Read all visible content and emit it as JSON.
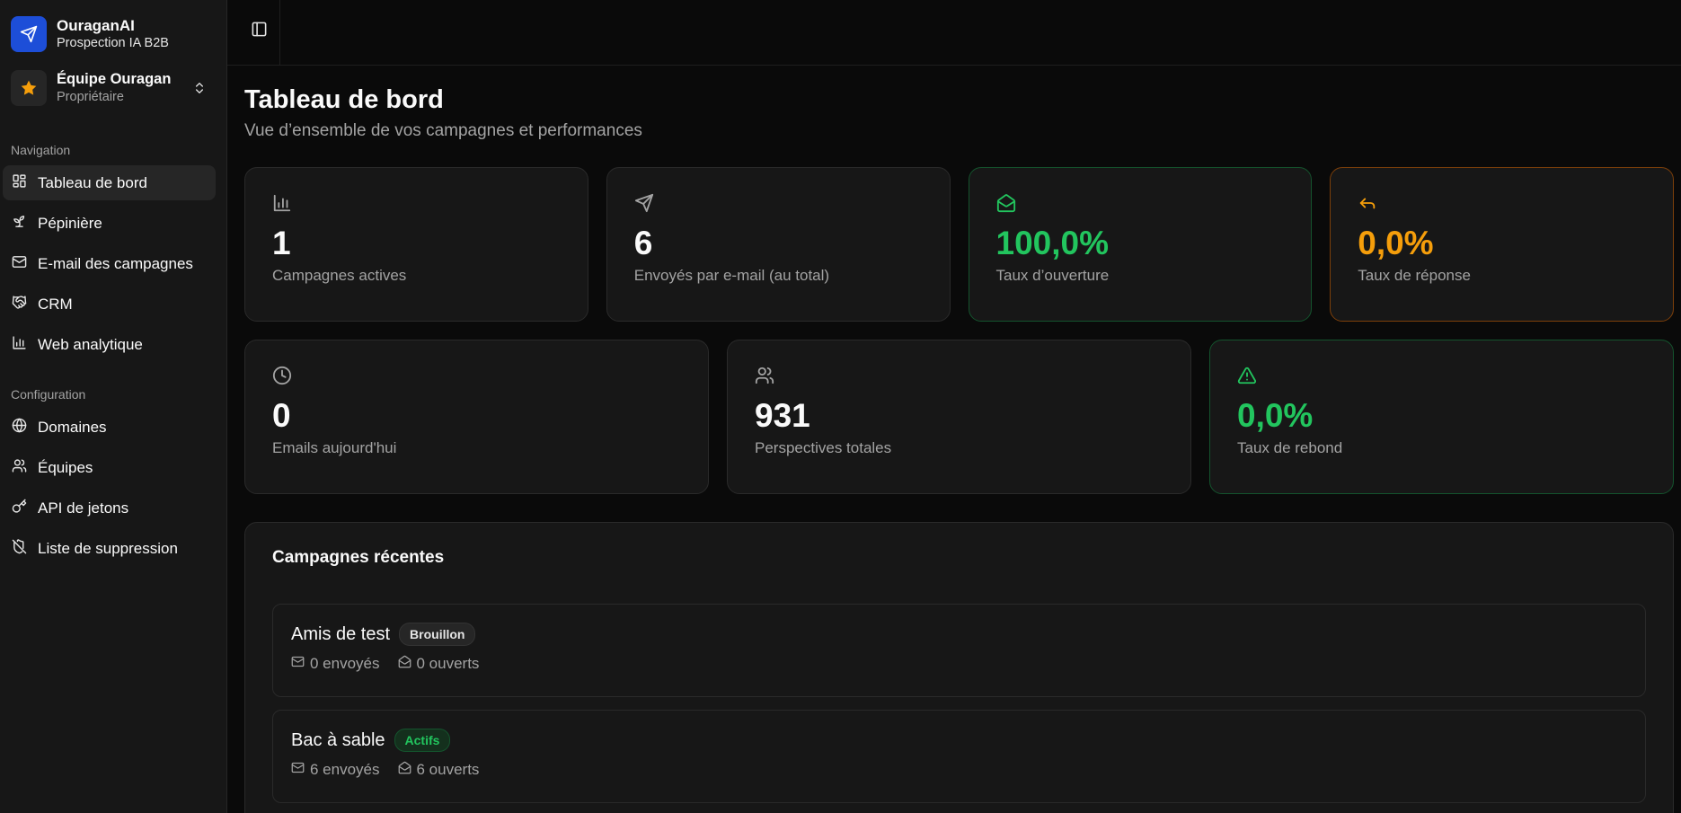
{
  "brand": {
    "name": "OuraganAI",
    "tagline": "Prospection IA B2B",
    "logo_icon": "send-icon"
  },
  "team": {
    "name": "Équipe Ouragan",
    "role": "Propriétaire",
    "icon": "star-icon"
  },
  "sidebar": {
    "nav_label": "Navigation",
    "nav_items": [
      {
        "label": "Tableau de bord",
        "icon": "dashboard-icon",
        "active": true
      },
      {
        "label": "Pépinière",
        "icon": "sprout-icon"
      },
      {
        "label": "E-mail des campagnes",
        "icon": "mail-icon"
      },
      {
        "label": "CRM",
        "icon": "handshake-icon"
      },
      {
        "label": "Web analytique",
        "icon": "bar-chart-icon"
      }
    ],
    "config_label": "Configuration",
    "config_items": [
      {
        "label": "Domaines",
        "icon": "globe-icon"
      },
      {
        "label": "Équipes",
        "icon": "users-icon"
      },
      {
        "label": "API de jetons",
        "icon": "key-icon"
      },
      {
        "label": "Liste de suppression",
        "icon": "shield-off-icon"
      }
    ]
  },
  "header": {
    "title": "Tableau de bord",
    "subtitle": "Vue d’ensemble de vos campagnes et performances"
  },
  "stats_row1": [
    {
      "value": "1",
      "label": "Campagnes actives",
      "icon": "bar-chart-icon",
      "tone": "neutral"
    },
    {
      "value": "6",
      "label": "Envoyés par e-mail (au total)",
      "icon": "send-icon",
      "tone": "neutral"
    },
    {
      "value": "100,0%",
      "label": "Taux d’ouverture",
      "icon": "mail-open-icon",
      "tone": "green"
    },
    {
      "value": "0,0%",
      "label": "Taux de réponse",
      "icon": "reply-icon",
      "tone": "orange"
    }
  ],
  "stats_row2": [
    {
      "value": "0",
      "label": "Emails aujourd'hui",
      "icon": "clock-icon",
      "tone": "neutral"
    },
    {
      "value": "931",
      "label": "Perspectives totales",
      "icon": "users-icon",
      "tone": "neutral"
    },
    {
      "value": "0,0%",
      "label": "Taux de rebond",
      "icon": "warning-icon",
      "tone": "green"
    }
  ],
  "recent": {
    "title": "Campagnes récentes",
    "campaigns": [
      {
        "name": "Amis de test",
        "status": "Brouillon",
        "sent": "0 envoyés",
        "opened": "0 ouverts"
      },
      {
        "name": "Bac à sable",
        "status": "Actifs",
        "sent": "6 envoyés",
        "opened": "6 ouverts"
      }
    ]
  },
  "colors": {
    "accent_green": "#22c55e",
    "accent_orange": "#f59e0b",
    "brand_blue": "#1d4ed8",
    "background": "#0a0a0a"
  }
}
